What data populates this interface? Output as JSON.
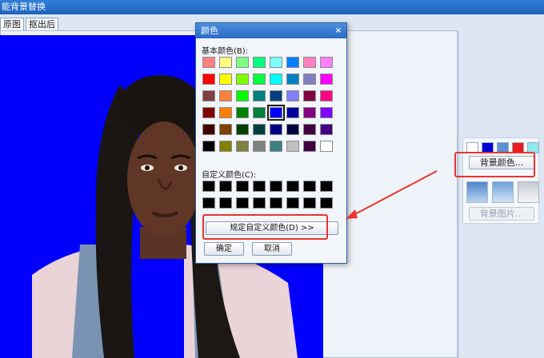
{
  "app": {
    "title": "能背景替换"
  },
  "tabs": [
    {
      "label": "原图",
      "active": true
    },
    {
      "label": "抠出后",
      "active": false
    }
  ],
  "right_panel": {
    "swatches": [
      "#ffffff",
      "#0000d8",
      "#5b8fd6",
      "#e81c1c",
      "#8ee8ee"
    ],
    "bg_color_button": "背景颜色...",
    "gradients": [
      "blue-gradient",
      "light-blue-gradient",
      "gray-gradient"
    ],
    "bg_image_button": "背景图片..."
  },
  "dialog": {
    "title": "颜色",
    "close_glyph": "×",
    "basic_label": "基本颜色(B):",
    "custom_label": "自定义颜色(C):",
    "define_button": "规定自定义颜色(D) >>",
    "ok_button": "确定",
    "cancel_button": "取消",
    "basic_colors": [
      "#ff8080",
      "#ffff80",
      "#80ff80",
      "#00ff80",
      "#80ffff",
      "#0080ff",
      "#ff80c0",
      "#ff80ff",
      "#ff0000",
      "#ffff00",
      "#80ff00",
      "#00ff40",
      "#00ffff",
      "#0080c0",
      "#8080c0",
      "#ff00ff",
      "#804040",
      "#ff8040",
      "#00ff00",
      "#008080",
      "#004080",
      "#8080ff",
      "#800040",
      "#ff0080",
      "#800000",
      "#ff8000",
      "#008000",
      "#008040",
      "#0000ff",
      "#0000a0",
      "#800080",
      "#8000ff",
      "#400000",
      "#804000",
      "#004000",
      "#004040",
      "#000080",
      "#000040",
      "#400040",
      "#400080",
      "#000000",
      "#808000",
      "#808040",
      "#808080",
      "#408080",
      "#c0c0c0",
      "#400040",
      "#ffffff"
    ],
    "selected_index": 28,
    "custom_colors": [
      "#000000",
      "#000000",
      "#000000",
      "#000000",
      "#000000",
      "#000000",
      "#000000",
      "#000000",
      "#000000",
      "#000000",
      "#000000",
      "#000000",
      "#000000",
      "#000000",
      "#000000",
      "#000000"
    ]
  },
  "colors": {
    "photo_background": "#0000fc",
    "annotation_red": "#e8352e"
  }
}
